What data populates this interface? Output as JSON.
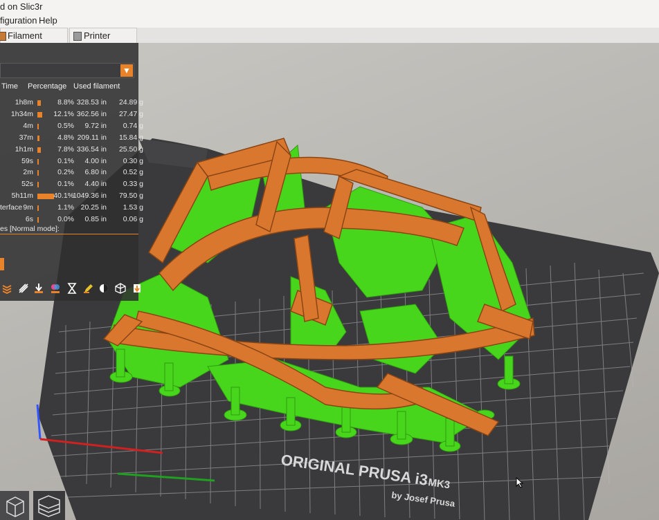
{
  "app": {
    "title_fragment": "d on Slic3r",
    "menu": [
      "figuration",
      "Help"
    ]
  },
  "tabs": [
    {
      "label": "Filament Settings",
      "icon": "filament-icon"
    },
    {
      "label": "Printer Settings",
      "icon": "printer-icon"
    }
  ],
  "stats": {
    "headers": {
      "time": "Time",
      "percentage": "Percentage",
      "used_filament": "Used filament"
    },
    "rows": [
      {
        "label": "",
        "time": "1h8m",
        "pct": "8.8%",
        "pct_value": 8.8,
        "length": "328.53 in",
        "weight": "24.89 g"
      },
      {
        "label": "",
        "time": "1h34m",
        "pct": "12.1%",
        "pct_value": 12.1,
        "length": "362.56 in",
        "weight": "27.47 g"
      },
      {
        "label": "",
        "time": "4m",
        "pct": "0.5%",
        "pct_value": 0.5,
        "length": "9.72 in",
        "weight": "0.74 g"
      },
      {
        "label": "",
        "time": "37m",
        "pct": "4.8%",
        "pct_value": 4.8,
        "length": "209.11 in",
        "weight": "15.84 g"
      },
      {
        "label": "",
        "time": "1h1m",
        "pct": "7.8%",
        "pct_value": 7.8,
        "length": "336.54 in",
        "weight": "25.50 g"
      },
      {
        "label": "",
        "time": "59s",
        "pct": "0.1%",
        "pct_value": 0.1,
        "length": "4.00 in",
        "weight": "0.30 g"
      },
      {
        "label": "",
        "time": "2m",
        "pct": "0.2%",
        "pct_value": 0.2,
        "length": "6.80 in",
        "weight": "0.52 g"
      },
      {
        "label": "",
        "time": "52s",
        "pct": "0.1%",
        "pct_value": 0.1,
        "length": "4.40 in",
        "weight": "0.33 g"
      },
      {
        "label": "",
        "time": "5h11m",
        "pct": "40.1%",
        "pct_value": 40.1,
        "length": "1049.36 in",
        "weight": "79.50 g"
      },
      {
        "label": "terface",
        "time": "9m",
        "pct": "1.1%",
        "pct_value": 1.1,
        "length": "20.25 in",
        "weight": "1.53 g"
      },
      {
        "label": "",
        "time": "6s",
        "pct": "0.0%",
        "pct_value": 0.0,
        "length": "0.85 in",
        "weight": "0.06 g"
      }
    ],
    "footer_caption": "es [Normal mode]:"
  },
  "bed": {
    "brand_line": "ORIGINAL PRUSA i3",
    "model": "MK3",
    "byline": "by Josef Prusa"
  },
  "toolbar_icons": [
    "layers-icon",
    "shells-icon",
    "move-down-icon",
    "color-icon",
    "hourglass-icon",
    "pencil-icon",
    "half-circle-icon",
    "cube-outline-icon",
    "export-icon"
  ],
  "colors": {
    "accent": "#e8832a",
    "model": "#d9772e",
    "support": "#48d61c",
    "bed": "#3d3d3f",
    "panel": "#2e2e30"
  }
}
